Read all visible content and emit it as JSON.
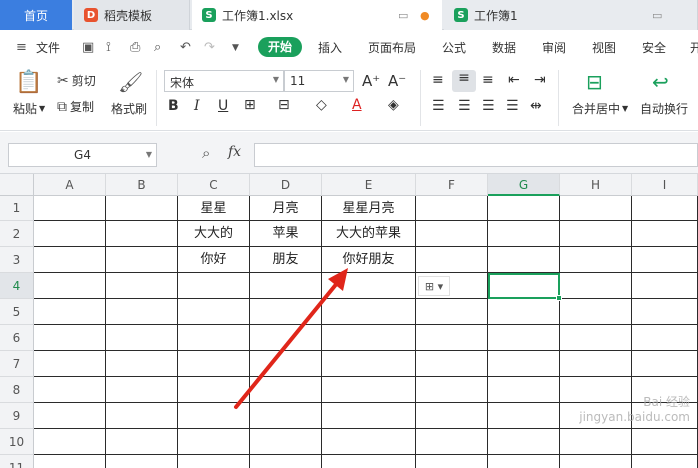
{
  "tabs": {
    "home": "首页",
    "template": "稻壳模板",
    "workbook1": "工作簿1.xlsx",
    "workbook": "工作簿1"
  },
  "menu": {
    "file": "文件",
    "start": "开始",
    "insert": "插入",
    "page_layout": "页面布局",
    "formula": "公式",
    "data": "数据",
    "review": "审阅",
    "view": "视图",
    "security": "安全",
    "dev": "开"
  },
  "ribbon": {
    "paste": "粘贴",
    "cut": "剪切",
    "copy": "复制",
    "format_painter": "格式刷",
    "font_name": "宋体",
    "font_size": "11",
    "merge_center": "合并居中",
    "wrap_text": "自动换行"
  },
  "formula_bar": {
    "cell_ref": "G4",
    "fx": "fx",
    "value": ""
  },
  "columns": [
    "A",
    "B",
    "C",
    "D",
    "E",
    "F",
    "G",
    "H",
    "I"
  ],
  "rows": [
    "1",
    "2",
    "3",
    "4",
    "5",
    "6",
    "7",
    "8",
    "9",
    "10",
    "11"
  ],
  "cells": {
    "C1": "星星",
    "D1": "月亮",
    "E1": "星星月亮",
    "C2": "大大的",
    "D2": "苹果",
    "E2": "大大的苹果",
    "C3": "你好",
    "D3": "朋友",
    "E3": "你好朋友"
  },
  "selected": "G4",
  "colors": {
    "accent": "#1aa05c",
    "home_tab": "#3b7ee0",
    "arrow": "#e0261a"
  },
  "watermark": {
    "line1": "Bai 经验",
    "line2": "jingyan.baidu.com"
  }
}
